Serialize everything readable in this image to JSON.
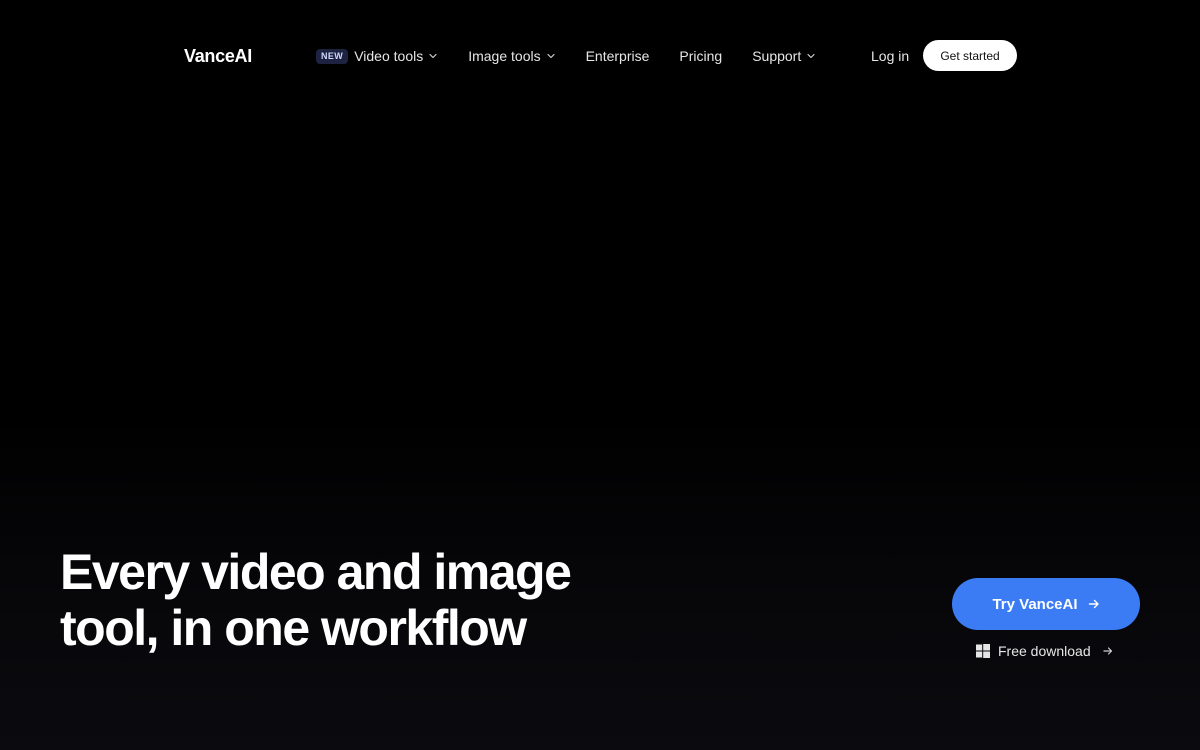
{
  "header": {
    "logo": "VanceAI",
    "nav": [
      {
        "label": "Video tools",
        "badge": "NEW",
        "has_dropdown": true
      },
      {
        "label": "Image tools",
        "has_dropdown": true
      },
      {
        "label": "Enterprise",
        "has_dropdown": false
      },
      {
        "label": "Pricing",
        "has_dropdown": false
      },
      {
        "label": "Support",
        "has_dropdown": true
      }
    ],
    "login_label": "Log in",
    "get_started_label": "Get started"
  },
  "hero": {
    "title_line1": "Every video and image",
    "title_line2": "tool, in one workflow",
    "primary_cta_label": "Try VanceAI",
    "secondary_cta_label": "Free download"
  },
  "colors": {
    "background": "#000000",
    "accent": "#3b7cf5",
    "badge_bg": "#1c2240"
  },
  "icons": {
    "dropdown": "chevron-down-icon",
    "cta_arrow": "arrow-right-icon",
    "download_platform": "windows-icon"
  }
}
